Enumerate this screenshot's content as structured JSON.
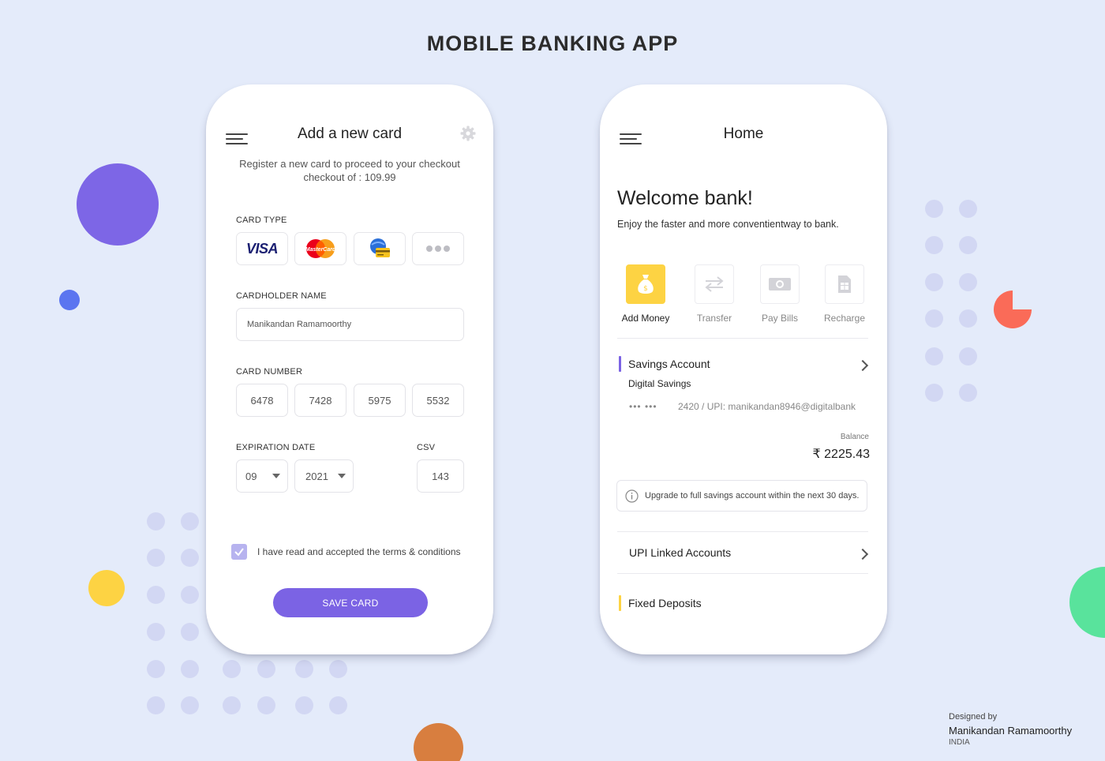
{
  "page": {
    "title": "MOBILE BANKING APP"
  },
  "colors": {
    "background": "#e4ebfa",
    "accent_purple": "#7b63e4",
    "accent_yellow": "#fdd343",
    "accent_red": "#fa6b58",
    "accent_green": "#59e39c",
    "accent_orange": "#d87e3f"
  },
  "add_card_screen": {
    "title": "Add a new card",
    "subtitle_line1": "Register a new card to proceed to your checkout",
    "subtitle_line2": "checkout of : 109.99",
    "card_type_label": "CARD TYPE",
    "card_types": [
      {
        "name": "VISA",
        "icon": "visa-logo"
      },
      {
        "name": "MasterCard",
        "icon": "mastercard-logo"
      },
      {
        "name": "",
        "icon": "globe-card-logo"
      },
      {
        "name": "",
        "icon": "more-dots-icon"
      }
    ],
    "cardholder_label": "CARDHOLDER NAME",
    "cardholder_value": "Manikandan Ramamoorthy",
    "card_number_label": "CARD NUMBER",
    "card_number": [
      "6478",
      "7428",
      "5975",
      "5532"
    ],
    "expiration_label": "EXPIRATION DATE",
    "exp_month": "09",
    "exp_year": "2021",
    "csv_label": "CSV",
    "csv_value": "143",
    "terms_text": "I have read and accepted the terms & conditions",
    "terms_checked": true,
    "save_button": "SAVE CARD"
  },
  "home_screen": {
    "title": "Home",
    "welcome": "Welcome bank!",
    "welcome_sub": "Enjoy the faster and more conventientway to bank.",
    "actions": [
      {
        "label": "Add Money",
        "icon": "money-bag-icon",
        "active": true
      },
      {
        "label": "Transfer",
        "icon": "transfer-arrows-icon",
        "active": false
      },
      {
        "label": "Pay Bills",
        "icon": "cash-icon",
        "active": false
      },
      {
        "label": "Recharge",
        "icon": "sim-card-icon",
        "active": false
      }
    ],
    "savings": {
      "title": "Savings Account",
      "type": "Digital Savings",
      "masked": "••• •••",
      "account_info": "2420 / UPI: manikandan8946@digitalbank",
      "balance_label": "Balance",
      "balance": "₹ 2225.43"
    },
    "notice": "Upgrade to full savings account within the next 30 days.",
    "upi_title": "UPI Linked Accounts",
    "fixed_title": "Fixed Deposits"
  },
  "footer": {
    "designed_by": "Designed by",
    "name": "Manikandan Ramamoorthy",
    "country": "INDIA"
  }
}
